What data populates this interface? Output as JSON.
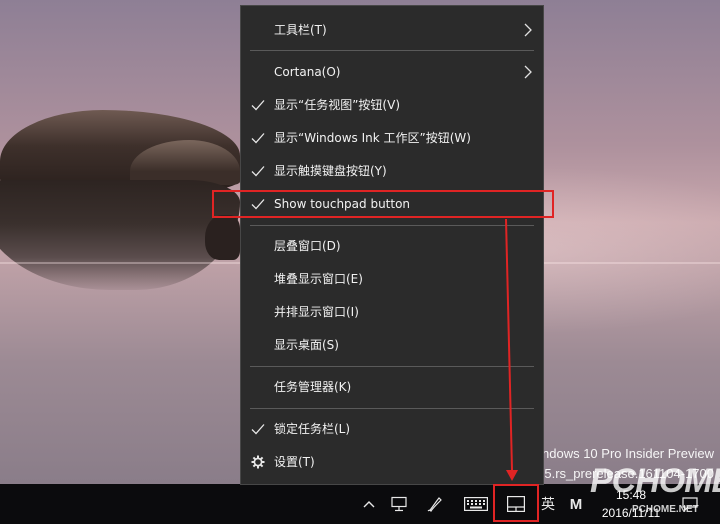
{
  "context_menu": {
    "items": [
      {
        "label": "工具栏(T)",
        "checked": false,
        "submenu": true
      },
      {
        "label": "Cortana(O)",
        "checked": false,
        "submenu": true
      },
      {
        "label": "显示“任务视图”按钮(V)",
        "checked": true,
        "submenu": false
      },
      {
        "label": "显示“Windows Ink 工作区”按钮(W)",
        "checked": true,
        "submenu": false
      },
      {
        "label": "显示触摸键盘按钮(Y)",
        "checked": true,
        "submenu": false
      },
      {
        "label": "Show touchpad button",
        "checked": true,
        "submenu": false,
        "highlighted": true
      },
      {
        "label": "层叠窗口(D)",
        "checked": false,
        "submenu": false
      },
      {
        "label": "堆叠显示窗口(E)",
        "checked": false,
        "submenu": false
      },
      {
        "label": "并排显示窗口(I)",
        "checked": false,
        "submenu": false
      },
      {
        "label": "显示桌面(S)",
        "checked": false,
        "submenu": false
      },
      {
        "label": "任务管理器(K)",
        "checked": false,
        "submenu": false
      },
      {
        "label": "锁定任务栏(L)",
        "checked": true,
        "submenu": false
      },
      {
        "label": "设置(T)",
        "checked": false,
        "submenu": false,
        "icon": "gear-icon"
      }
    ]
  },
  "desktop": {
    "watermark_line1": "ndows 10 Pro Insider Preview",
    "watermark_line2": "55.rs_prerelease.161104-1700"
  },
  "taskbar": {
    "tray_icons": [
      "chevron-up-icon",
      "network-icon",
      "windows-ink-icon",
      "touch-keyboard-icon",
      "touchpad-icon"
    ],
    "ime_label": "英",
    "ime_mode": "M",
    "time": "15:48",
    "date": "2016/11/11"
  },
  "branding": {
    "logo_text": "PCHOME",
    "logo_url_text": "PCHOME.NET"
  },
  "colors": {
    "menu_bg": "#2b2b2b",
    "highlight": "#e02424",
    "taskbar_bg": "#0b0b0d"
  }
}
